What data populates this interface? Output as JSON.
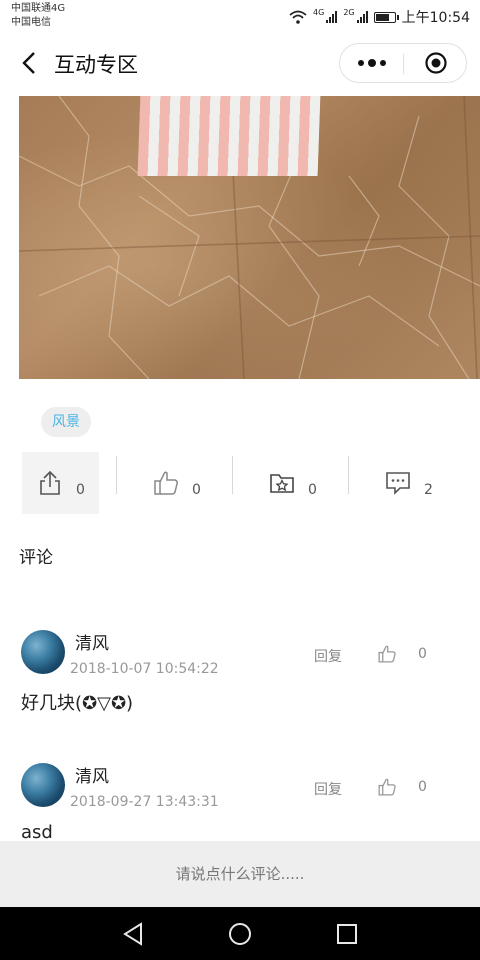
{
  "status_bar": {
    "carrier_1": "中国联通4G",
    "carrier_2": "中国电信",
    "network_1": "4G",
    "network_2": "2G",
    "time": "上午10:54",
    "battery_level": 0.75
  },
  "nav": {
    "title": "互动专区",
    "back_icon": "chevron-left-icon",
    "more_icon": "more-dots-icon",
    "close_icon": "target-close-icon"
  },
  "post": {
    "tag": "风景",
    "stats": {
      "share_count": "0",
      "like_count": "0",
      "collect_count": "0",
      "comment_count": "2"
    }
  },
  "comments": {
    "heading": "评论",
    "reply_label": "回复",
    "items": [
      {
        "name": "清风",
        "time": "2018-10-07 10:54:22",
        "likes": "0",
        "text": "好几块(✪▽✪)"
      },
      {
        "name": "清风",
        "time": "2018-09-27 13:43:31",
        "likes": "0",
        "text": "asd"
      }
    ]
  },
  "input": {
    "placeholder": "请说点什么评论....."
  },
  "colors": {
    "tag_text": "#4cb4e6",
    "tag_bg": "#eeeeee",
    "input_bar_bg": "#eeeeee",
    "system_nav_bg": "#000000"
  }
}
